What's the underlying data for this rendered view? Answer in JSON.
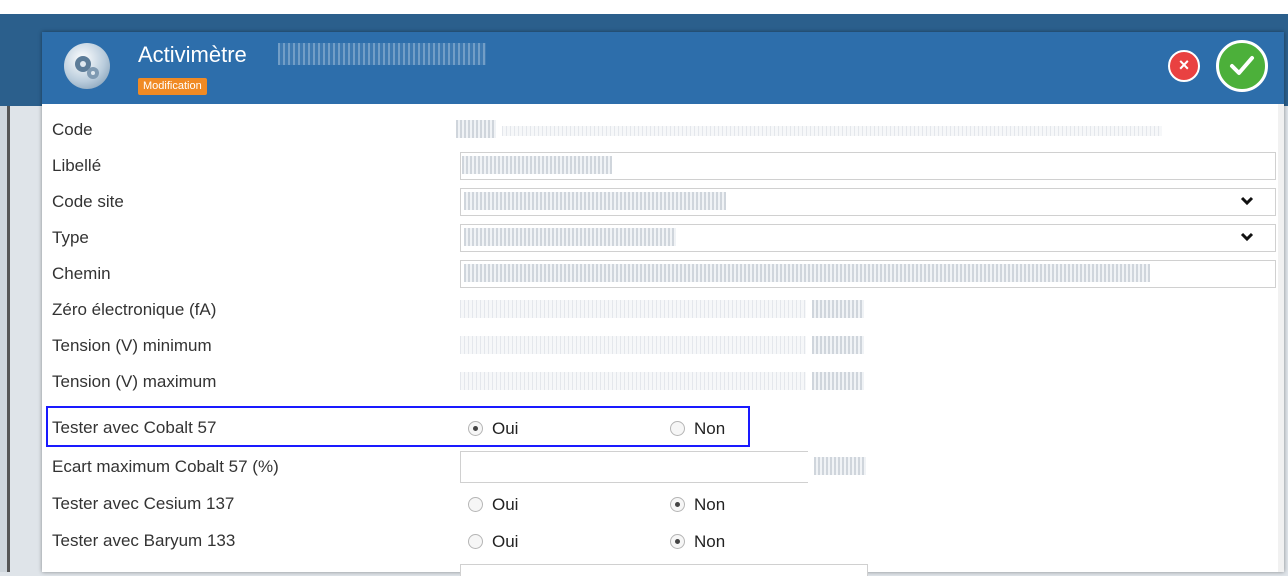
{
  "window": {
    "title": "Activimètre",
    "mode_badge": "Modification"
  },
  "actions": {
    "cancel_icon": "close-icon",
    "confirm_icon": "checkmark-icon"
  },
  "form": {
    "fields": [
      {
        "label": "Code"
      },
      {
        "label": "Libellé"
      },
      {
        "label": "Code site"
      },
      {
        "label": "Type"
      },
      {
        "label": "Chemin"
      },
      {
        "label": "Zéro électronique (fA)"
      },
      {
        "label": "Tension (V) minimum"
      },
      {
        "label": "Tension (V) maximum"
      },
      {
        "label": "Tester avec Cobalt 57",
        "options": [
          "Oui",
          "Non"
        ],
        "selected": "Oui"
      },
      {
        "label": "Ecart maximum Cobalt 57 (%)"
      },
      {
        "label": "Tester avec Cesium 137",
        "options": [
          "Oui",
          "Non"
        ],
        "selected": "Non"
      },
      {
        "label": "Tester avec Baryum 133",
        "options": [
          "Oui",
          "Non"
        ],
        "selected": "Non"
      }
    ]
  },
  "colors": {
    "header": "#2d6eab",
    "badge": "#f08a24",
    "cancel": "#e94141",
    "confirm": "#4cb03a",
    "highlight": "#1a1aff"
  }
}
